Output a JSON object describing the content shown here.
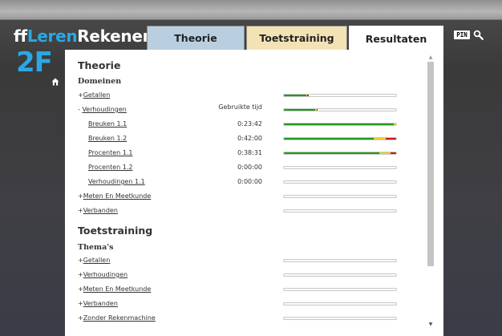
{
  "brand": {
    "ff": "ff",
    "leren": "Leren",
    "rekenen": "Rekenen",
    "level": "2F"
  },
  "tabs": [
    {
      "label": "Theorie"
    },
    {
      "label": "Toetstraining"
    },
    {
      "label": "Resultaten"
    }
  ],
  "pin_label": "PIN",
  "theorie": {
    "title": "Theorie",
    "subtitle": "Domeinen",
    "time_header": "Gebruikte tijd",
    "rows": [
      {
        "prefix": "+",
        "label": "Getallen",
        "time": "",
        "progress": {
          "green": 0.2,
          "yellow": 0.01,
          "red": 0.01
        }
      },
      {
        "prefix": "- ",
        "label": "Verhoudingen",
        "time": "",
        "progress": {
          "green": 0.28,
          "yellow": 0.01,
          "red": 0.01
        }
      },
      {
        "prefix": "",
        "label": "Breuken 1.1",
        "time": "0:23:42",
        "progress": {
          "green": 0.98,
          "yellow": 0.02,
          "red": 0
        }
      },
      {
        "prefix": "",
        "label": "Breuken 1.2",
        "time": "0:42:00",
        "progress": {
          "green": 0.8,
          "yellow": 0.11,
          "red": 0.09
        }
      },
      {
        "prefix": "",
        "label": "Procenten 1.1",
        "time": "0:38:31",
        "progress": {
          "green": 0.85,
          "yellow": 0.1,
          "red": 0.05
        }
      },
      {
        "prefix": "",
        "label": "Procenten 1.2",
        "time": "0:00:00",
        "progress": {
          "green": 0,
          "yellow": 0,
          "red": 0
        }
      },
      {
        "prefix": "",
        "label": "Verhoudingen 1.1",
        "time": "0:00:00",
        "progress": {
          "green": 0,
          "yellow": 0,
          "red": 0
        }
      },
      {
        "prefix": "+",
        "label": "Meten En Meetkunde",
        "time": "",
        "progress": {
          "green": 0,
          "yellow": 0,
          "red": 0
        }
      },
      {
        "prefix": "+",
        "label": "Verbanden",
        "time": "",
        "progress": {
          "green": 0,
          "yellow": 0,
          "red": 0
        }
      }
    ]
  },
  "toetstraining": {
    "title": "Toetstraining",
    "subtitle": "Thema's",
    "rows": [
      {
        "prefix": "+",
        "label": "Getallen"
      },
      {
        "prefix": "+",
        "label": "Verhoudingen"
      },
      {
        "prefix": "+",
        "label": "Meten En Meetkunde"
      },
      {
        "prefix": "+",
        "label": "Verbanden"
      },
      {
        "prefix": "+",
        "label": "Zonder Rekenmachine"
      }
    ]
  },
  "colors": {
    "green": "#1e9a1e",
    "yellow": "#e8d21c",
    "red": "#c8161d",
    "accent": "#2aa8e6"
  },
  "icons": {
    "home": "home-icon",
    "search": "search-icon"
  }
}
